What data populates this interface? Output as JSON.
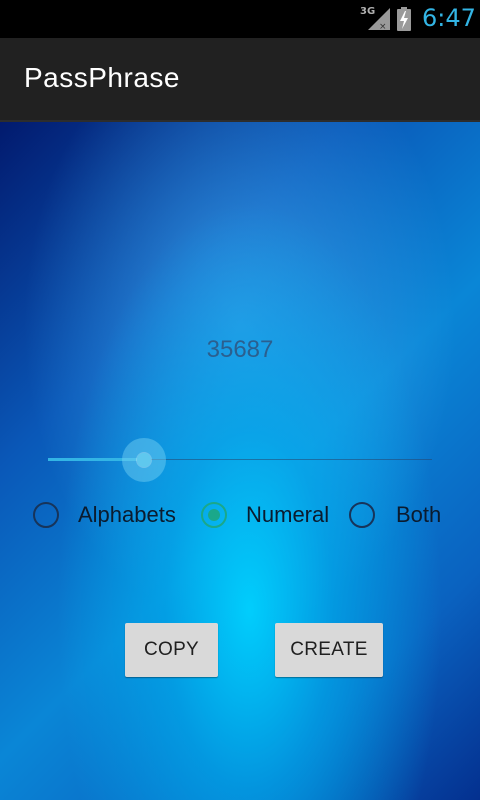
{
  "status_bar": {
    "network_type": "3G",
    "network_icon": "signal-no-data-icon",
    "battery_icon": "battery-charging-icon",
    "time": "6:47",
    "time_color": "#33b5e5"
  },
  "action_bar": {
    "title": "PassPhrase"
  },
  "main": {
    "passphrase": "35687",
    "length_slider": {
      "value_fraction": 0.25
    },
    "character_type": {
      "options": [
        {
          "label": "Alphabets",
          "checked": false
        },
        {
          "label": "Numeral",
          "checked": true
        },
        {
          "label": "Both",
          "checked": false
        }
      ],
      "checked_color": "#1aa88a"
    },
    "buttons": {
      "copy_label": "COPY",
      "create_label": "CREATE"
    }
  }
}
